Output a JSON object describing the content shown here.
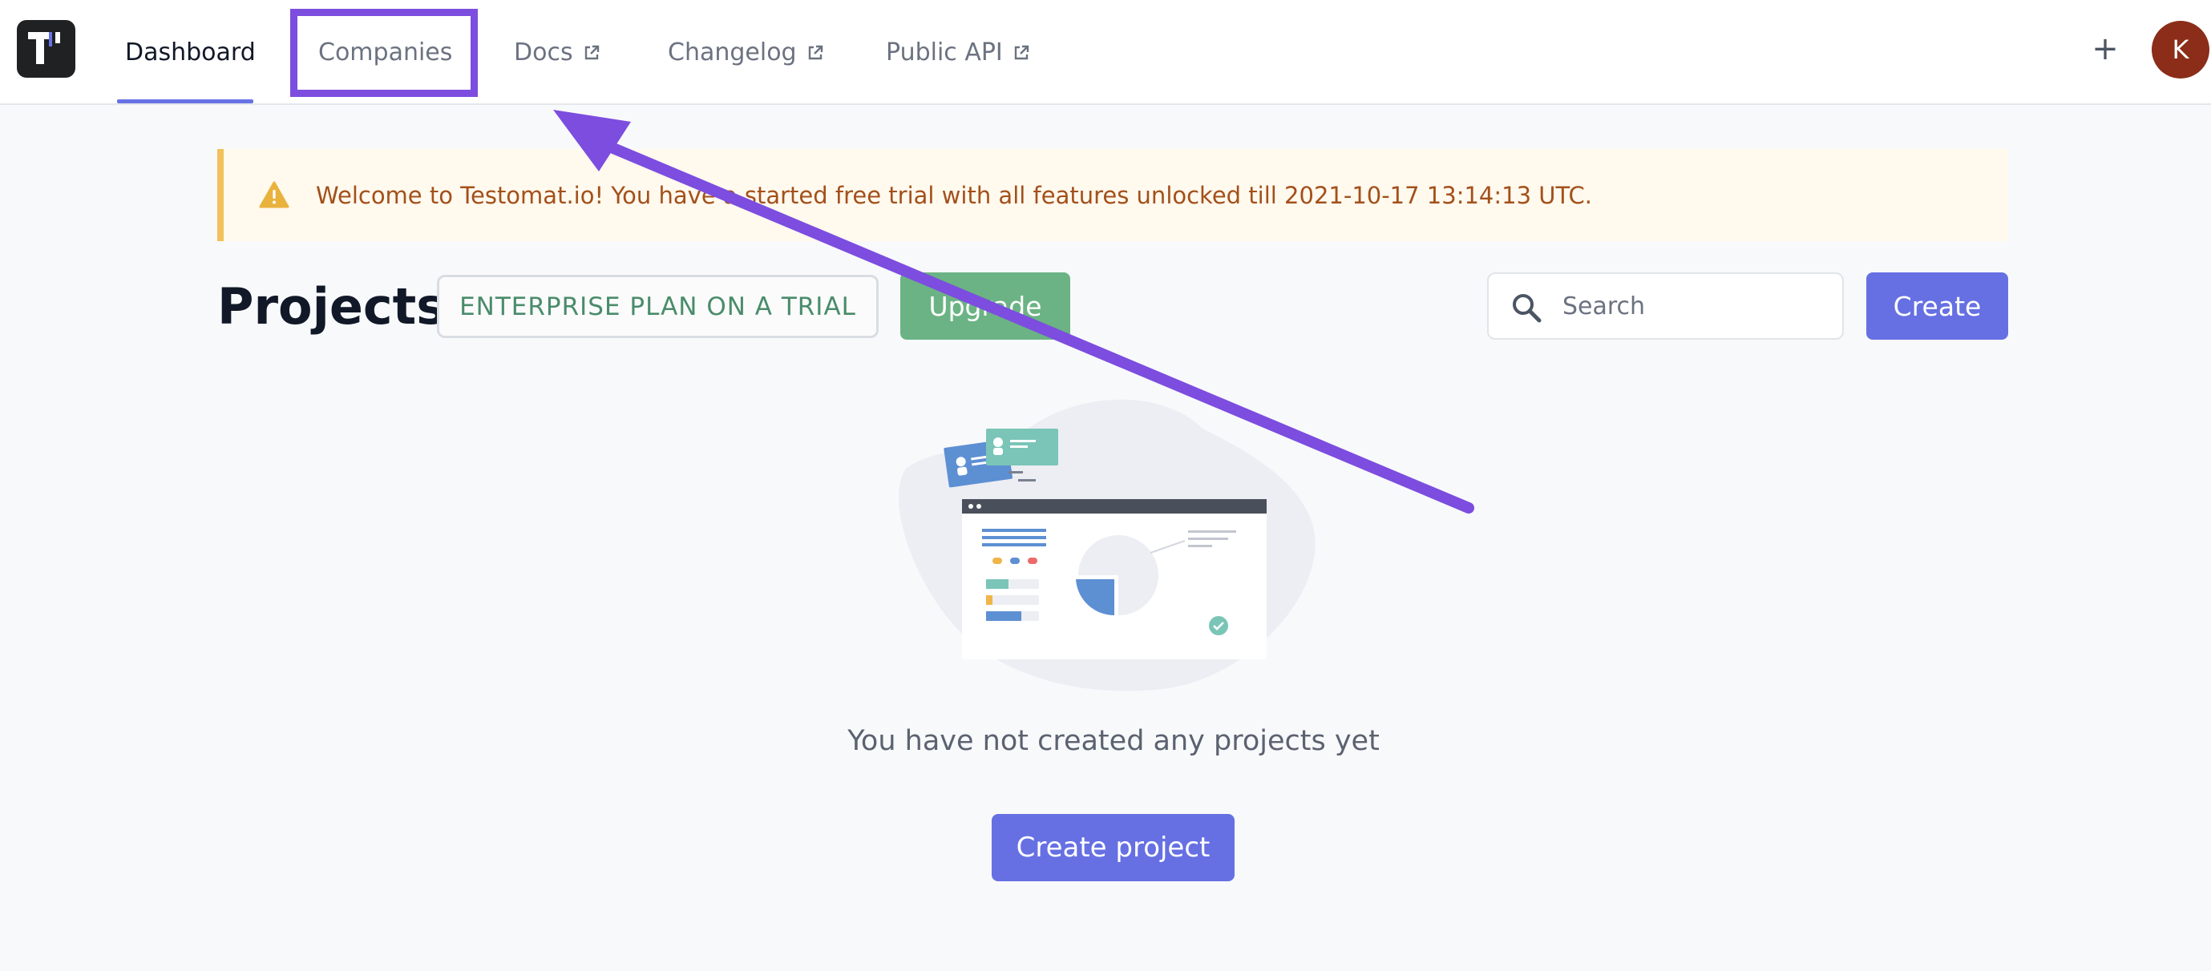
{
  "nav": {
    "items": [
      {
        "label": "Dashboard",
        "external": false,
        "active": true
      },
      {
        "label": "Companies",
        "external": false,
        "active": false
      },
      {
        "label": "Docs",
        "external": true,
        "active": false
      },
      {
        "label": "Changelog",
        "external": true,
        "active": false
      },
      {
        "label": "Public API",
        "external": true,
        "active": false
      }
    ],
    "plus_label": "+",
    "avatar_initial": "K"
  },
  "alert": {
    "text": "Welcome to Testomat.io! You have a started free trial with all features unlocked till 2021-10-17 13:14:13 UTC.",
    "icon": "warning-icon"
  },
  "projects": {
    "title": "Projects",
    "plan_badge": "ENTERPRISE PLAN ON A TRIAL",
    "upgrade_label": "Upgrade",
    "search_placeholder": "Search",
    "create_label": "Create",
    "empty_text": "You have not created any projects yet",
    "create_project_label": "Create project"
  },
  "colors": {
    "accent": "#6670e3",
    "upgrade": "#6bb384",
    "alert_text": "#a3501a",
    "alert_border": "#f1c15a",
    "annotation": "#7c4ddf",
    "avatar_bg": "#8b2d18"
  }
}
